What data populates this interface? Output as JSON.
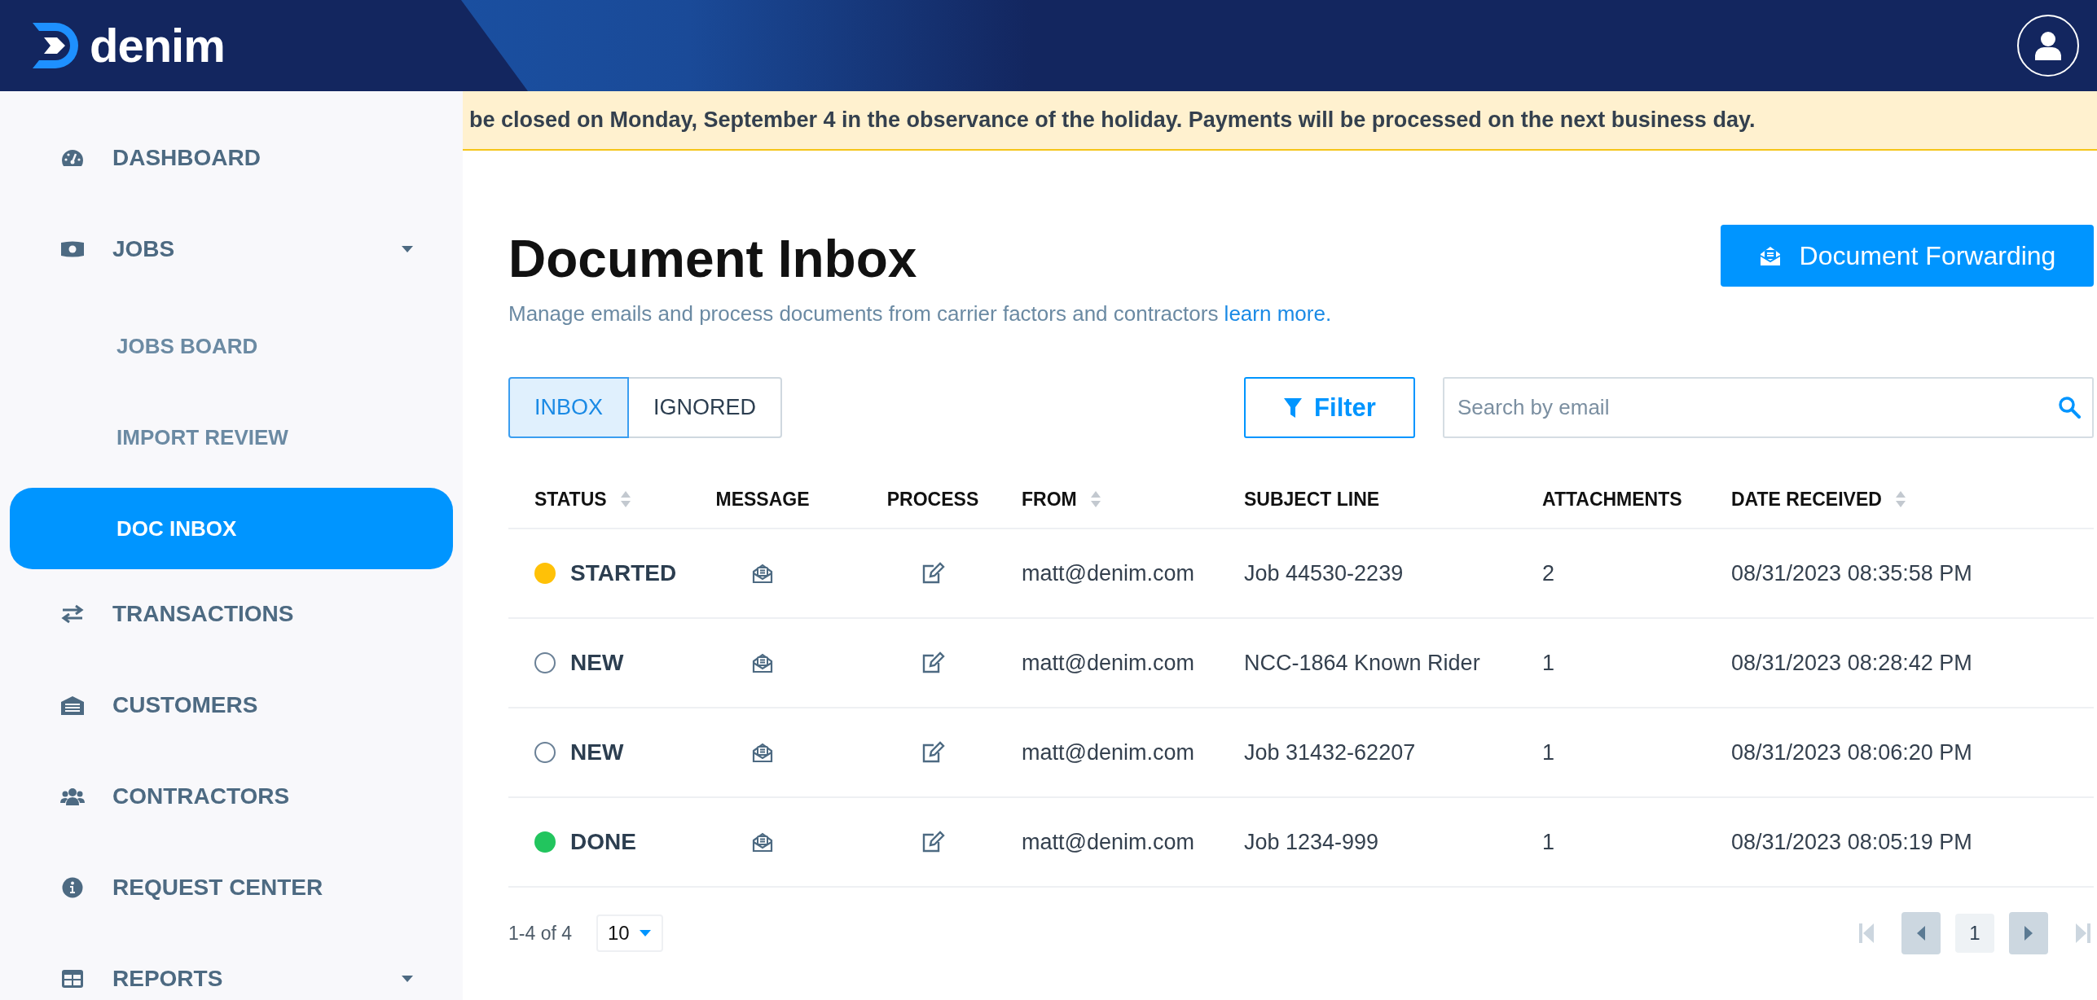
{
  "header": {
    "logo_text": "denim"
  },
  "banner": {
    "text": "be closed on Monday, September 4 in the observance of the holiday. Payments will be processed on the next business day."
  },
  "sidebar": {
    "items": [
      {
        "label": "DASHBOARD",
        "selected": false,
        "has_caret": false
      },
      {
        "label": "JOBS",
        "selected": false,
        "has_caret": true,
        "children": [
          {
            "label": "JOBS BOARD",
            "selected": false
          },
          {
            "label": "IMPORT REVIEW",
            "selected": false
          },
          {
            "label": "DOC INBOX",
            "selected": true
          }
        ]
      },
      {
        "label": "TRANSACTIONS",
        "selected": false,
        "has_caret": false
      },
      {
        "label": "CUSTOMERS",
        "selected": false,
        "has_caret": false
      },
      {
        "label": "CONTRACTORS",
        "selected": false,
        "has_caret": false
      },
      {
        "label": "REQUEST CENTER",
        "selected": false,
        "has_caret": false
      },
      {
        "label": "REPORTS",
        "selected": false,
        "has_caret": true
      }
    ]
  },
  "page": {
    "title": "Document Inbox",
    "subtitle": "Manage emails and process documents from carrier factors and contractors",
    "subtitle_link": "learn more.",
    "primary_button": "Document Forwarding"
  },
  "tabs": [
    {
      "label": "INBOX",
      "selected": true
    },
    {
      "label": "IGNORED",
      "selected": false
    }
  ],
  "filter_button": "Filter",
  "search": {
    "placeholder": "Search by email"
  },
  "table": {
    "columns": [
      {
        "label": "STATUS",
        "sortable": true
      },
      {
        "label": "MESSAGE",
        "sortable": false
      },
      {
        "label": "PROCESS",
        "sortable": false
      },
      {
        "label": "FROM",
        "sortable": true
      },
      {
        "label": "SUBJECT LINE",
        "sortable": false
      },
      {
        "label": "ATTACHMENTS",
        "sortable": false
      },
      {
        "label": "DATE RECEIVED",
        "sortable": true
      }
    ],
    "rows": [
      {
        "status": "STARTED",
        "color": "#ffc107",
        "status_filled": true,
        "from": "matt@denim.com",
        "subject": "Job 44530-2239",
        "attachments": "2",
        "date": "08/31/2023 08:35:58 PM"
      },
      {
        "status": "NEW",
        "color": "#6b8197",
        "status_filled": false,
        "from": "matt@denim.com",
        "subject": "NCC-1864 Known Rider",
        "attachments": "1",
        "date": "08/31/2023 08:28:42 PM"
      },
      {
        "status": "NEW",
        "color": "#6b8197",
        "status_filled": false,
        "from": "matt@denim.com",
        "subject": "Job 31432-62207",
        "attachments": "1",
        "date": "08/31/2023 08:06:20 PM"
      },
      {
        "status": "DONE",
        "color": "#22c55e",
        "status_filled": true,
        "from": "matt@denim.com",
        "subject": "Job 1234-999",
        "attachments": "1",
        "date": "08/31/2023 08:05:19 PM"
      }
    ]
  },
  "pagination": {
    "range": "1-4 of 4",
    "per_page": "10",
    "page": "1",
    "prev_disabled": false,
    "next_disabled": false
  }
}
